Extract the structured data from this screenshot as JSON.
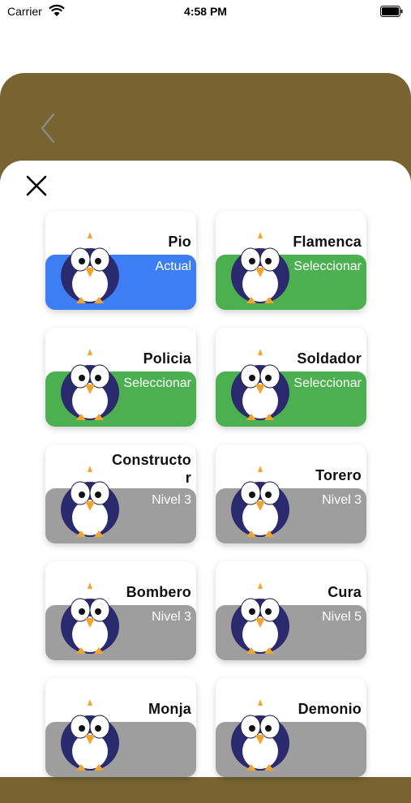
{
  "status_bar": {
    "carrier": "Carrier",
    "time": "4:58 PM"
  },
  "colors": {
    "back_sheet": "#776430",
    "current": "#3d7ef5",
    "selectable": "#4caf50",
    "locked": "#9e9e9e"
  },
  "characters": [
    {
      "name": "Pio",
      "status": "Actual",
      "state": "current",
      "icon": "penguin-pio-icon"
    },
    {
      "name": "Flamenca",
      "status": "Seleccionar",
      "state": "selectable",
      "icon": "penguin-flamenca-icon"
    },
    {
      "name": "Policia",
      "status": "Seleccionar",
      "state": "selectable",
      "icon": "penguin-policia-icon"
    },
    {
      "name": "Soldador",
      "status": "Seleccionar",
      "state": "selectable",
      "icon": "penguin-soldador-icon"
    },
    {
      "name": "Constructor",
      "status": "Nivel 3",
      "state": "locked",
      "icon": "penguin-constructor-icon"
    },
    {
      "name": "Torero",
      "status": "Nivel 3",
      "state": "locked",
      "icon": "penguin-torero-icon"
    },
    {
      "name": "Bombero",
      "status": "Nivel 3",
      "state": "locked",
      "icon": "penguin-bombero-icon"
    },
    {
      "name": "Cura",
      "status": "Nivel 5",
      "state": "locked",
      "icon": "penguin-cura-icon"
    },
    {
      "name": "Monja",
      "status": "",
      "state": "locked",
      "icon": "penguin-monja-icon"
    },
    {
      "name": "Demonio",
      "status": "",
      "state": "locked",
      "icon": "penguin-demonio-icon"
    }
  ]
}
